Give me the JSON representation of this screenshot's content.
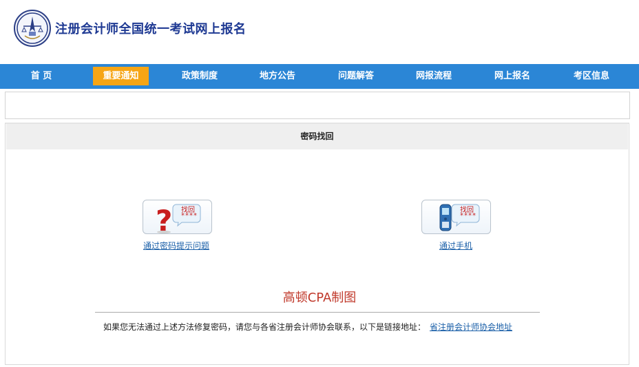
{
  "header": {
    "logo_icon": "association-emblem-icon",
    "title": "注册会计师全国统一考试网上报名"
  },
  "nav": {
    "items": [
      {
        "label": "首 页",
        "active": false
      },
      {
        "label": "重要通知",
        "active": true
      },
      {
        "label": "政策制度",
        "active": false
      },
      {
        "label": "地方公告",
        "active": false
      },
      {
        "label": "问题解答",
        "active": false
      },
      {
        "label": "网报流程",
        "active": false
      },
      {
        "label": "网上报名",
        "active": false
      },
      {
        "label": "考区信息",
        "active": false
      }
    ],
    "active_color": "#f6a515",
    "bar_color": "#2b86d6"
  },
  "panel": {
    "title": "密码找回",
    "options": [
      {
        "icon": "question-mark-icon",
        "badge_text": "找回",
        "badge_stars": "****",
        "link": "通过密码提示问题"
      },
      {
        "icon": "mobile-phone-icon",
        "badge_text": "找回",
        "badge_stars": "****",
        "link": "通过手机"
      }
    ],
    "watermark": "高顿CPA制图",
    "footer_text": "如果您无法通过上述方法修复密码，请您与各省注册会计师协会联系，以下是链接地址：",
    "footer_link": "省注册会计师协会地址"
  }
}
